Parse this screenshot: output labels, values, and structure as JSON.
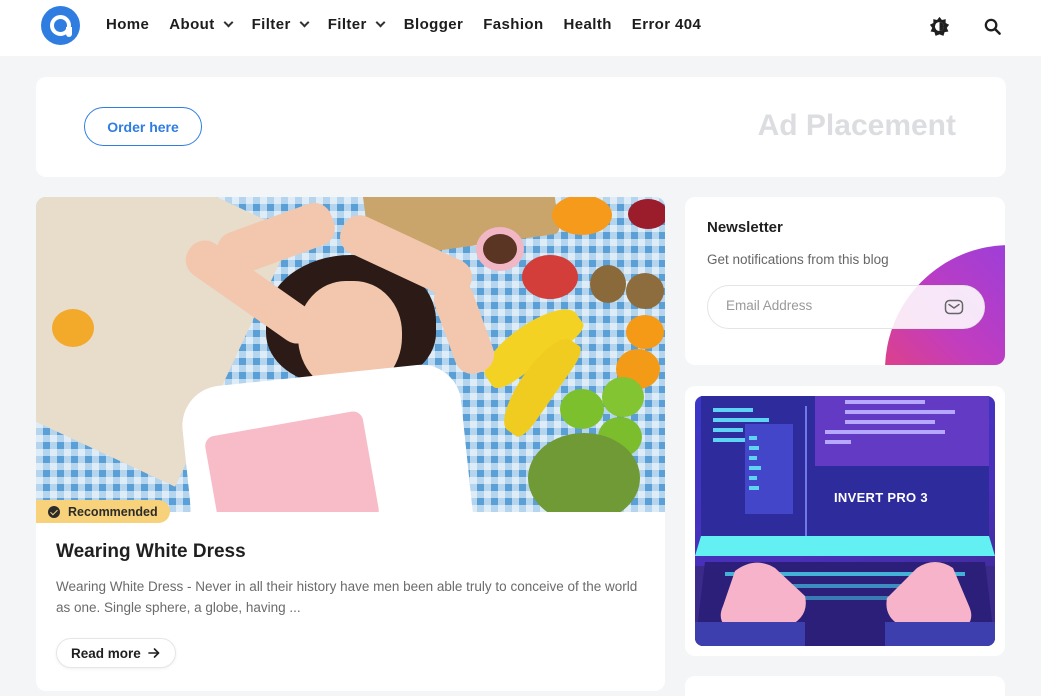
{
  "header": {
    "nav": [
      {
        "label": "Home",
        "dropdown": false
      },
      {
        "label": "About",
        "dropdown": true
      },
      {
        "label": "Filter",
        "dropdown": true
      },
      {
        "label": "Filter",
        "dropdown": true
      },
      {
        "label": "Blogger",
        "dropdown": false
      },
      {
        "label": "Fashion",
        "dropdown": false
      },
      {
        "label": "Health",
        "dropdown": false
      },
      {
        "label": "Error 404",
        "dropdown": false
      }
    ],
    "icons": [
      "logo-icon",
      "theme-toggle-icon",
      "search-icon"
    ]
  },
  "ad": {
    "button_label": "Order here",
    "label": "Ad Placement"
  },
  "post": {
    "badge": "Recommended",
    "title": "Wearing White Dress",
    "snippet": "Wearing White Dress - Never in all their history have men been able truly to conceive of the world as one. Single sphere, a globe, having ...",
    "read_more": "Read more"
  },
  "newsletter": {
    "title": "Newsletter",
    "subtitle": "Get notifications from this blog",
    "email_placeholder": "Email Address"
  },
  "promo": {
    "label": "INVERT PRO 3"
  },
  "colors": {
    "accent": "#2f7de1",
    "badge": "#f7d27a",
    "background": "#f4f5f7"
  }
}
